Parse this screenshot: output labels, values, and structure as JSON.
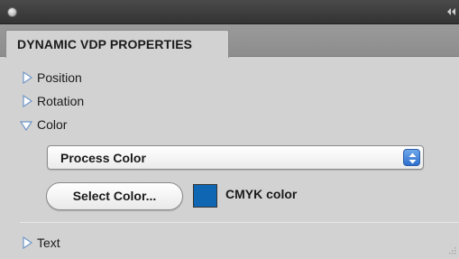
{
  "panel": {
    "tab_label": "DYNAMIC VDP PROPERTIES"
  },
  "sections": {
    "position": {
      "label": "Position",
      "expanded": false
    },
    "rotation": {
      "label": "Rotation",
      "expanded": false
    },
    "color": {
      "label": "Color",
      "expanded": true
    },
    "text": {
      "label": "Text",
      "expanded": false
    }
  },
  "color_section": {
    "select_value": "Process Color",
    "select_color_button": "Select Color...",
    "swatch_color": "#0f67b4",
    "swatch_label": "CMYK color"
  },
  "icons": {
    "close": "close-dot-icon",
    "collapse": "double-chevron-left-icon",
    "expand": "disclosure-triangle-right-icon",
    "collapse_section": "disclosure-triangle-down-icon",
    "resize": "resize-grip-icon"
  }
}
